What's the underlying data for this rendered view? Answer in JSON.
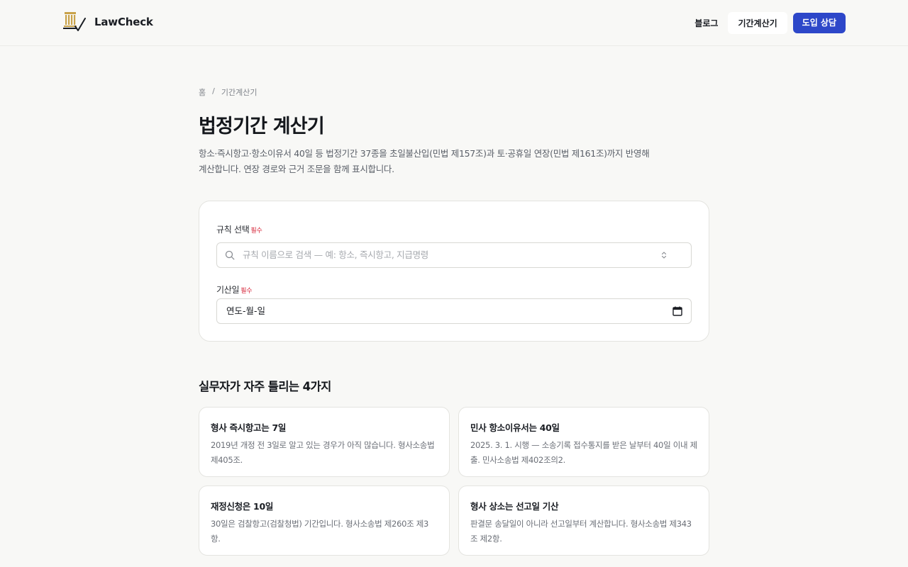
{
  "header": {
    "logo_text": "LawCheck",
    "nav": {
      "blog": "블로그",
      "calculator": "기간계산기",
      "cta": "도입 상담"
    }
  },
  "page_progress": {
    "percent": 100
  },
  "breadcrumb": {
    "home": "홈",
    "separator": "/",
    "current": "기간계산기"
  },
  "page": {
    "title": "법정기간 계산기",
    "description": "항소·즉시항고·항소이유서 40일 등 법정기간 37종을 초일불산입(민법 제157조)과 토·공휴일 연장(민법 제161조)까지 반영해 계산합니다. 연장 경로와 근거 조문을 함께 표시합니다."
  },
  "form": {
    "rule": {
      "label": "규칙 선택",
      "required": "필수",
      "placeholder": "규칙 이름으로 검색 — 예: 항소, 즉시항고, 지급명령"
    },
    "start_date": {
      "label": "기산일",
      "required": "필수",
      "value": "연도-월-일"
    }
  },
  "tips": {
    "title": "실무자가 자주 틀리는 4가지",
    "items": [
      {
        "title": "형사 즉시항고는 7일",
        "body": "2019년 개정 전 3일로 알고 있는 경우가 아직 많습니다. 형사소송법 제405조."
      },
      {
        "title": "민사 항소이유서는 40일",
        "body": "2025. 3. 1. 시행 — 소송기록 접수통지를 받은 날부터 40일 이내 제출. 민사소송법 제402조의2."
      },
      {
        "title": "재정신청은 10일",
        "body": "30일은 검찰항고(검찰청법) 기간입니다. 형사소송법 제260조 제3항."
      },
      {
        "title": "형사 상소는 선고일 기산",
        "body": "판결문 송달일이 아니라 선고일부터 계산합니다. 형사소송법 제343조 제2항."
      }
    ]
  },
  "colors": {
    "accent": "#2d47c9",
    "progress": "#2f8fe0",
    "required": "#d6263a",
    "logo_gold": "#c9a24a"
  }
}
